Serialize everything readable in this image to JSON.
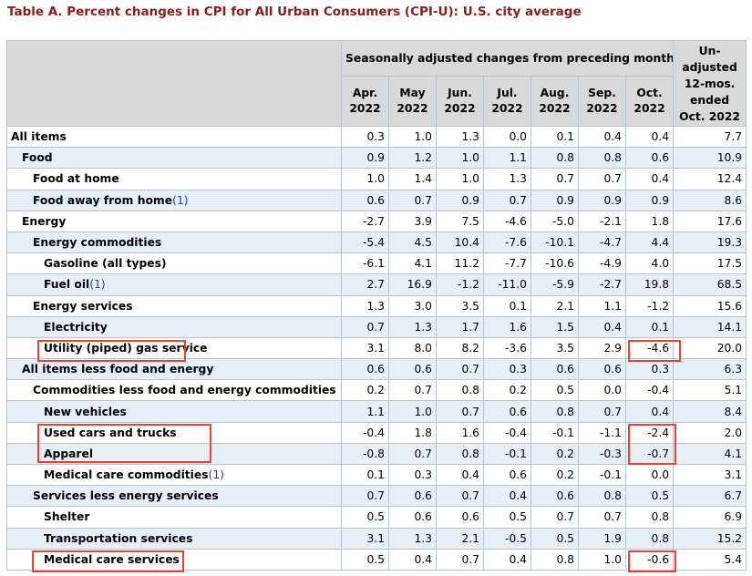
{
  "title": "Table A. Percent changes in CPI for All Urban Consumers (CPI-U): U.S. city average",
  "header": {
    "group_label": "Seasonally adjusted changes from preceding month",
    "months": [
      {
        "month": "Apr.",
        "year": "2022"
      },
      {
        "month": "May",
        "year": "2022"
      },
      {
        "month": "Jun.",
        "year": "2022"
      },
      {
        "month": "Jul.",
        "year": "2022"
      },
      {
        "month": "Aug.",
        "year": "2022"
      },
      {
        "month": "Sep.",
        "year": "2022"
      },
      {
        "month": "Oct.",
        "year": "2022"
      }
    ],
    "unadjusted_lines": [
      "Un-",
      "adjusted",
      "12-mos.",
      "ended",
      "Oct. 2022"
    ]
  },
  "footnote_marker": "(1)",
  "rows": [
    {
      "label": "All items",
      "indent": 0,
      "footnote": false,
      "values": [
        "0.3",
        "1.0",
        "1.3",
        "0.0",
        "0.1",
        "0.4",
        "0.4",
        "7.7"
      ]
    },
    {
      "label": "Food",
      "indent": 1,
      "footnote": false,
      "values": [
        "0.9",
        "1.2",
        "1.0",
        "1.1",
        "0.8",
        "0.8",
        "0.6",
        "10.9"
      ]
    },
    {
      "label": "Food at home",
      "indent": 2,
      "footnote": false,
      "values": [
        "1.0",
        "1.4",
        "1.0",
        "1.3",
        "0.7",
        "0.7",
        "0.4",
        "12.4"
      ]
    },
    {
      "label": "Food away from home",
      "indent": 2,
      "footnote": true,
      "values": [
        "0.6",
        "0.7",
        "0.9",
        "0.7",
        "0.9",
        "0.9",
        "0.9",
        "8.6"
      ]
    },
    {
      "label": "Energy",
      "indent": 1,
      "footnote": false,
      "values": [
        "-2.7",
        "3.9",
        "7.5",
        "-4.6",
        "-5.0",
        "-2.1",
        "1.8",
        "17.6"
      ]
    },
    {
      "label": "Energy commodities",
      "indent": 2,
      "footnote": false,
      "values": [
        "-5.4",
        "4.5",
        "10.4",
        "-7.6",
        "-10.1",
        "-4.7",
        "4.4",
        "19.3"
      ]
    },
    {
      "label": "Gasoline (all types)",
      "indent": 3,
      "footnote": false,
      "values": [
        "-6.1",
        "4.1",
        "11.2",
        "-7.7",
        "-10.6",
        "-4.9",
        "4.0",
        "17.5"
      ]
    },
    {
      "label": "Fuel oil",
      "indent": 3,
      "footnote": true,
      "values": [
        "2.7",
        "16.9",
        "-1.2",
        "-11.0",
        "-5.9",
        "-2.7",
        "19.8",
        "68.5"
      ]
    },
    {
      "label": "Energy services",
      "indent": 2,
      "footnote": false,
      "values": [
        "1.3",
        "3.0",
        "3.5",
        "0.1",
        "2.1",
        "1.1",
        "-1.2",
        "15.6"
      ]
    },
    {
      "label": "Electricity",
      "indent": 3,
      "footnote": false,
      "values": [
        "0.7",
        "1.3",
        "1.7",
        "1.6",
        "1.5",
        "0.4",
        "0.1",
        "14.1"
      ]
    },
    {
      "label": "Utility (piped) gas service",
      "indent": 3,
      "footnote": false,
      "values": [
        "3.1",
        "8.0",
        "8.2",
        "-3.6",
        "3.5",
        "2.9",
        "-4.6",
        "20.0"
      ]
    },
    {
      "label": "All items less food and energy",
      "indent": 1,
      "footnote": false,
      "values": [
        "0.6",
        "0.6",
        "0.7",
        "0.3",
        "0.6",
        "0.6",
        "0.3",
        "6.3"
      ]
    },
    {
      "label": "Commodities less food and energy commodities",
      "indent": 2,
      "footnote": false,
      "values": [
        "0.2",
        "0.7",
        "0.8",
        "0.2",
        "0.5",
        "0.0",
        "-0.4",
        "5.1"
      ]
    },
    {
      "label": "New vehicles",
      "indent": 3,
      "footnote": false,
      "values": [
        "1.1",
        "1.0",
        "0.7",
        "0.6",
        "0.8",
        "0.7",
        "0.4",
        "8.4"
      ]
    },
    {
      "label": "Used cars and trucks",
      "indent": 3,
      "footnote": false,
      "values": [
        "-0.4",
        "1.8",
        "1.6",
        "-0.4",
        "-0.1",
        "-1.1",
        "-2.4",
        "2.0"
      ]
    },
    {
      "label": "Apparel",
      "indent": 3,
      "footnote": false,
      "values": [
        "-0.8",
        "0.7",
        "0.8",
        "-0.1",
        "0.2",
        "-0.3",
        "-0.7",
        "4.1"
      ]
    },
    {
      "label": "Medical care commodities",
      "indent": 3,
      "footnote": true,
      "values": [
        "0.1",
        "0.3",
        "0.4",
        "0.6",
        "0.2",
        "-0.1",
        "0.0",
        "3.1"
      ]
    },
    {
      "label": "Services less energy services",
      "indent": 2,
      "footnote": false,
      "values": [
        "0.7",
        "0.6",
        "0.7",
        "0.4",
        "0.6",
        "0.8",
        "0.5",
        "6.7"
      ]
    },
    {
      "label": "Shelter",
      "indent": 3,
      "footnote": false,
      "values": [
        "0.5",
        "0.6",
        "0.6",
        "0.5",
        "0.7",
        "0.7",
        "0.8",
        "6.9"
      ]
    },
    {
      "label": "Transportation services",
      "indent": 3,
      "footnote": false,
      "values": [
        "3.1",
        "1.3",
        "2.1",
        "-0.5",
        "0.5",
        "1.9",
        "0.8",
        "15.2"
      ]
    },
    {
      "label": "Medical care services",
      "indent": 3,
      "footnote": false,
      "values": [
        "0.5",
        "0.4",
        "0.7",
        "0.4",
        "0.8",
        "1.0",
        "-0.6",
        "5.4"
      ]
    }
  ],
  "colors": {
    "title": "#8a1c1c",
    "header_bg": "#d9d9d9",
    "row_alt_bg": "#e6eef8",
    "highlight_border": "#e8432f",
    "footnote_link": "#1f3fbf"
  }
}
